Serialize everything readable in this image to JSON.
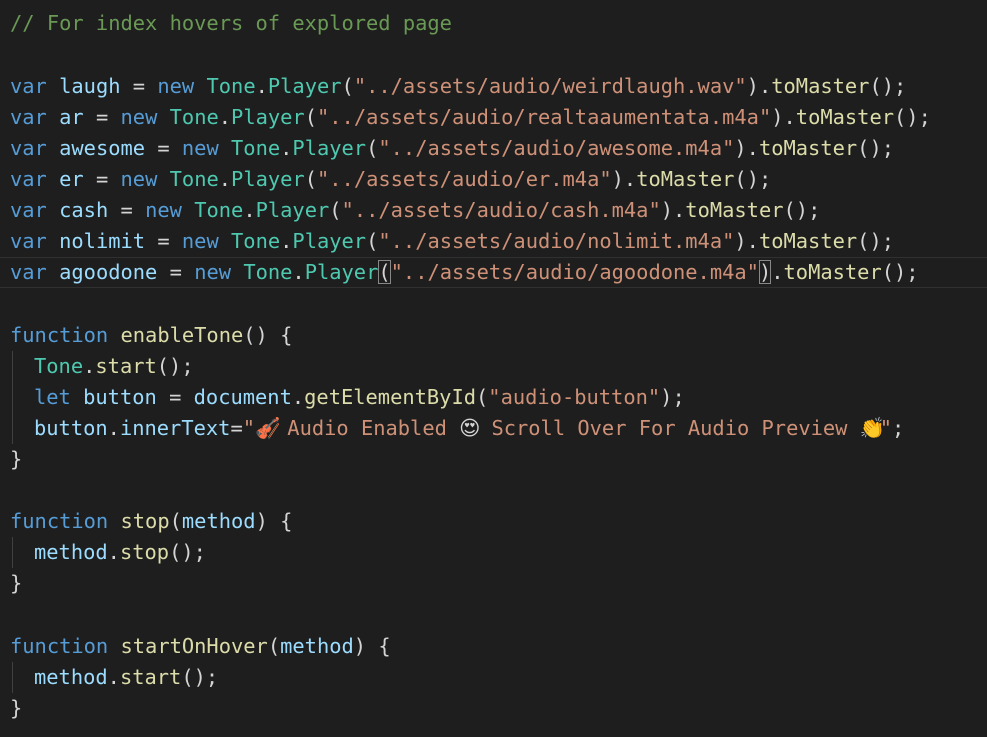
{
  "editor": {
    "comment": "// For index hovers of explored page",
    "players": [
      {
        "name": "laugh",
        "file": "\"../assets/audio/weirdlaugh.wav\""
      },
      {
        "name": "ar",
        "file": "\"../assets/audio/realtaaumentata.m4a\""
      },
      {
        "name": "awesome",
        "file": "\"../assets/audio/awesome.m4a\""
      },
      {
        "name": "er",
        "file": "\"../assets/audio/er.m4a\""
      },
      {
        "name": "cash",
        "file": "\"../assets/audio/cash.m4a\""
      },
      {
        "name": "nolimit",
        "file": "\"../assets/audio/nolimit.m4a\""
      },
      {
        "name": "agoodone",
        "file": "\"../assets/audio/agoodone.m4a\""
      }
    ],
    "tokens": {
      "var_kw": "var",
      "new_kw": "new",
      "tone": "Tone",
      "player": "Player",
      "to_master": "toMaster",
      "function_kw": "function",
      "let_kw": "let",
      "start": "start",
      "stop": "stop"
    },
    "enable_tone": {
      "name": "enableTone",
      "button_var": "button",
      "document": "document",
      "get_by_id": "getElementById",
      "button_id": "\"audio-button\"",
      "inner_text": "innerText",
      "text_part1": "\"",
      "text_part2": " Audio Enabled ",
      "text_part3": " Scroll Over For Audio Preview ",
      "text_part4": "\""
    },
    "stop_fn": {
      "name": "stop",
      "param": "method"
    },
    "start_on_hover_fn": {
      "name": "startOnHover",
      "param": "method"
    },
    "emojis": {
      "violin": "🎻",
      "heart_eyes": "😍",
      "clap": "👏"
    }
  }
}
